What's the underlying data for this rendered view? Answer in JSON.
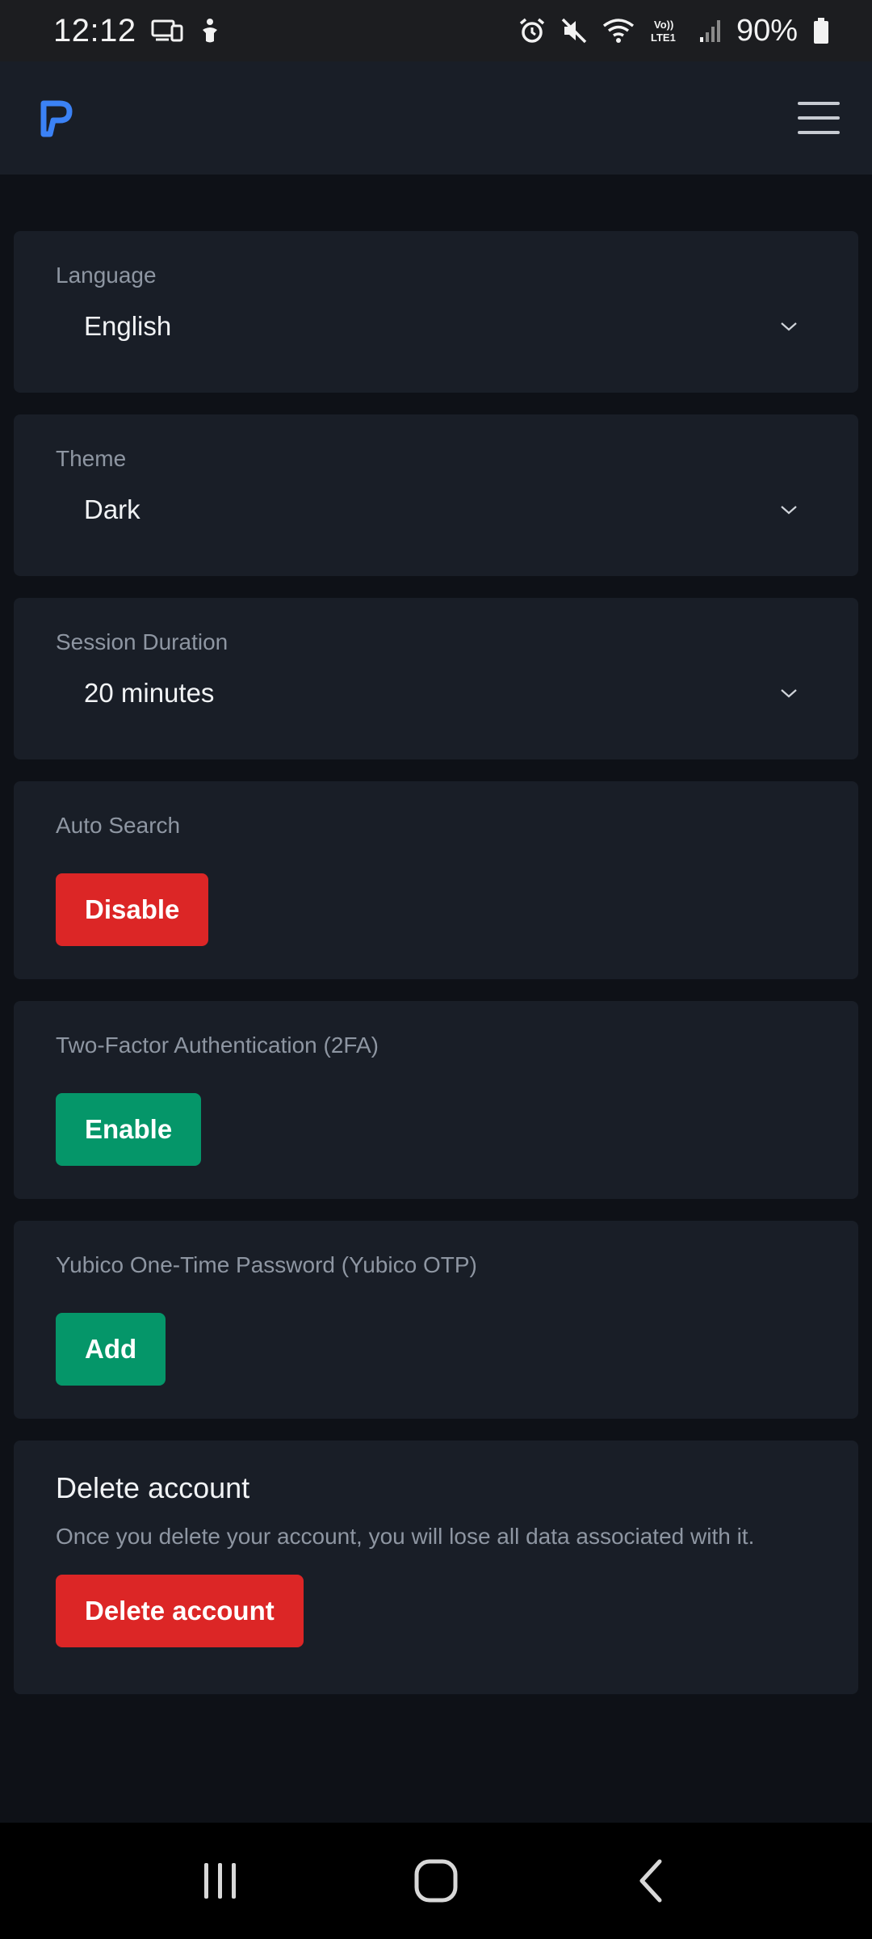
{
  "status_bar": {
    "time": "12:12",
    "battery": "90%",
    "icons": [
      "cast-icon",
      "accessibility-icon",
      "alarm-icon",
      "mute-icon",
      "wifi-icon",
      "volte-icon",
      "signal-icon",
      "battery-icon"
    ]
  },
  "app_bar": {
    "logo": "p-logo-icon",
    "menu_icon": "hamburger-menu-icon",
    "accent_color": "#3b82f6"
  },
  "settings": {
    "language": {
      "label": "Language",
      "value": "English"
    },
    "theme": {
      "label": "Theme",
      "value": "Dark"
    },
    "session_duration": {
      "label": "Session Duration",
      "value": "20 minutes"
    },
    "auto_search": {
      "label": "Auto Search",
      "button": "Disable"
    },
    "two_factor": {
      "label": "Two-Factor Authentication (2FA)",
      "button": "Enable"
    },
    "yubico": {
      "label": "Yubico One-Time Password (Yubico OTP)",
      "button": "Add"
    }
  },
  "delete_account": {
    "title": "Delete account",
    "description": "Once you delete your account, you will lose all data associated with it.",
    "button": "Delete account"
  },
  "colors": {
    "danger": "#dc2626",
    "success": "#059669",
    "card_bg": "#191e27",
    "page_bg": "#0e1117"
  },
  "nav_bar": {
    "icons": [
      "recent-apps-icon",
      "home-icon",
      "back-icon"
    ]
  }
}
